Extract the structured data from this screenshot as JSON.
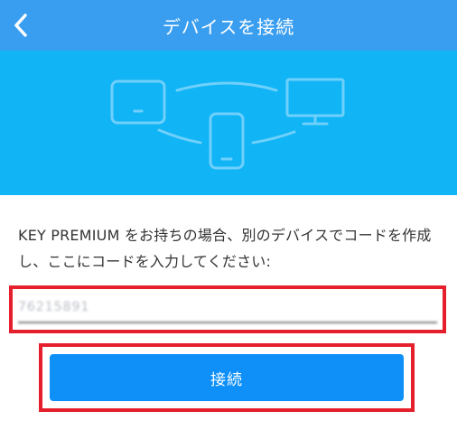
{
  "header": {
    "title": "デバイスを接続",
    "back_icon": "chevron-left-icon"
  },
  "banner": {
    "illustration": "connected-devices-icon",
    "colors": {
      "background": "#11b4f5",
      "line": "#6fd0fb"
    }
  },
  "description": "KEY PREMIUM をお持ちの場合、別のデバイスでコードを作成し、ここにコードを入力してください:",
  "code_input": {
    "value": "76215891"
  },
  "connect_button": {
    "label": "接続"
  },
  "colors": {
    "header": "#3a9ef0",
    "button": "#0e90f8",
    "highlight_border": "#e51f2c"
  }
}
